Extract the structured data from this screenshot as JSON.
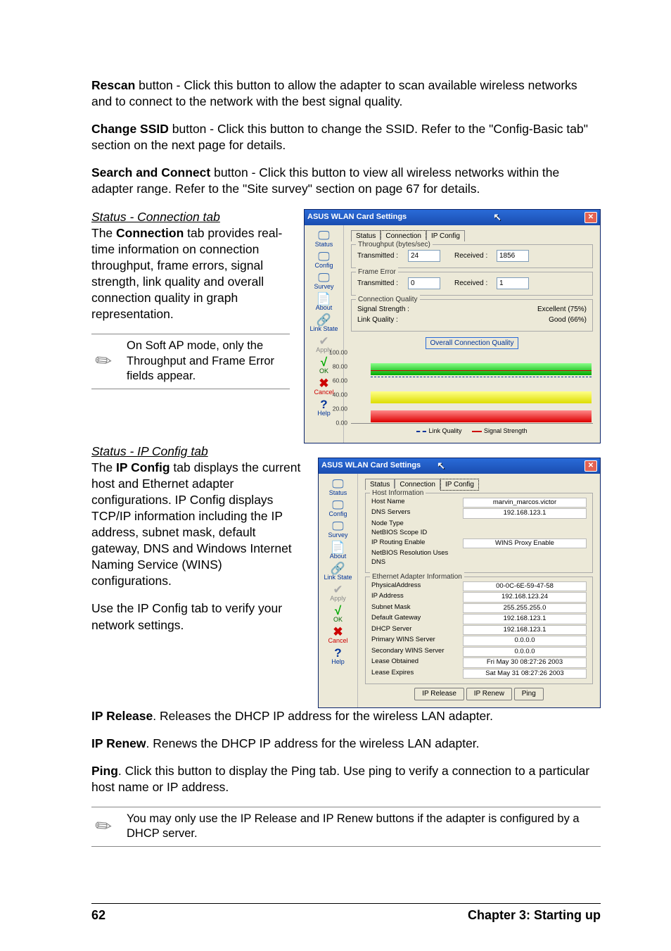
{
  "body": {
    "rescan_b": "Rescan",
    "rescan_t": " button - Click this button to allow the adapter to scan available wireless networks and to connect to the network with the best signal quality.",
    "changessid_b": "Change SSID",
    "changessid_t": " button - Click this button to change the SSID. Refer to the \"Config-Basic tab\" section on the next page for details.",
    "search_b": "Search and Connect",
    "search_t": " button - Click this button to view all wireless networks within the adapter range. Refer to the \"Site survey\" section on page 67 for details.",
    "sec1_title": "Status - Connection tab",
    "sec1_p": "The Connection tab provides real-time information on connection throughput, frame errors, signal strength, link quality and overall connection quality in graph representation.",
    "sec1_p_pre": "The ",
    "sec1_p_bold": "Connection",
    "sec1_p_post": " tab provides real-time information on connection throughput, frame errors, signal strength, link quality and overall connection quality in graph representation.",
    "note1": "On Soft AP mode, only the Throughput and Frame Error fields appear.",
    "sec2_title": "Status - IP Config tab",
    "sec2_p_pre": "The ",
    "sec2_p_bold": "IP Config",
    "sec2_p_post": " tab displays the current host and Ethernet adapter configurations. IP Config displays TCP/IP information including the IP address, subnet mask, default gateway, DNS and Windows Internet Naming Service (WINS) configurations.",
    "sec2_use": "Use the IP Config tab to verify your network settings.",
    "iprelease_b": "IP Release",
    "iprelease_t": ". Releases the DHCP IP address for the wireless LAN adapter.",
    "iprenew_b": "IP Renew",
    "iprenew_t": ". Renews the DHCP IP address for the wireless LAN adapter.",
    "ping_b": "Ping",
    "ping_t": ". Click this button to display the Ping tab. Use ping to verify a connection to a particular host name or IP address.",
    "note2": "You may only use the IP Release and IP Renew buttons if the adapter is configured by a DHCP server."
  },
  "footer": {
    "page": "62",
    "chapter": "Chapter 3: Starting up"
  },
  "win_conn": {
    "title": "ASUS WLAN Card Settings",
    "tabs": {
      "status": "Status",
      "connection": "Connection",
      "ipconfig": "IP Config"
    },
    "throughput_title": "Throughput (bytes/sec)",
    "frameerror_title": "Frame Error",
    "connq_title": "Connection Quality",
    "transmitted": "Transmitted :",
    "received": "Received :",
    "tx_val1": "24",
    "rx_val1": "1856",
    "tx_val2": "0",
    "rx_val2": "1",
    "sig_lbl": "Signal Strength :",
    "sig_val": "Excellent (75%)",
    "lq_lbl": "Link Quality :",
    "lq_val": "Good (66%)",
    "graph_title": "Overall Connection Quality",
    "yticks": [
      "100.00",
      "80.00",
      "60.00",
      "40.00",
      "20.00",
      "0.00"
    ],
    "legend_lq": "Link Quality",
    "legend_ss": "Signal Strength"
  },
  "win_ip": {
    "title": "ASUS WLAN Card Settings",
    "tabs": {
      "status": "Status",
      "connection": "Connection",
      "ipconfig": "IP Config"
    },
    "host_title": "Host Information",
    "eth_title": "Ethernet Adapter Information",
    "host": [
      {
        "lbl": "Host Name",
        "val": "marvin_marcos.victor"
      },
      {
        "lbl": "DNS Servers",
        "val": "192.168.123.1"
      },
      {
        "lbl": "Node Type",
        "val": ""
      },
      {
        "lbl": "NetBIOS Scope ID",
        "val": ""
      },
      {
        "lbl": "IP Routing Enable",
        "val": "WINS Proxy Enable"
      },
      {
        "lbl": "NetBIOS Resolution Uses DNS",
        "val": ""
      }
    ],
    "eth": [
      {
        "lbl": "PhysicalAddress",
        "val": "00-0C-6E-59-47-58"
      },
      {
        "lbl": "IP Address",
        "val": "192.168.123.24"
      },
      {
        "lbl": "Subnet Mask",
        "val": "255.255.255.0"
      },
      {
        "lbl": "Default Gateway",
        "val": "192.168.123.1"
      },
      {
        "lbl": "DHCP Server",
        "val": "192.168.123.1"
      },
      {
        "lbl": "Primary WINS Server",
        "val": "0.0.0.0"
      },
      {
        "lbl": "Secondary WINS Server",
        "val": "0.0.0.0"
      },
      {
        "lbl": "Lease Obtained",
        "val": "Fri May 30 08:27:26 2003"
      },
      {
        "lbl": "Lease Expires",
        "val": "Sat May 31 08:27:26 2003"
      }
    ],
    "btn_release": "IP Release",
    "btn_renew": "IP Renew",
    "btn_ping": "Ping"
  },
  "sidebar": {
    "status": "Status",
    "config": "Config",
    "survey": "Survey",
    "about": "About",
    "linkstate": "Link State",
    "apply": "Apply",
    "ok": "OK",
    "cancel": "Cancel",
    "help": "Help"
  }
}
